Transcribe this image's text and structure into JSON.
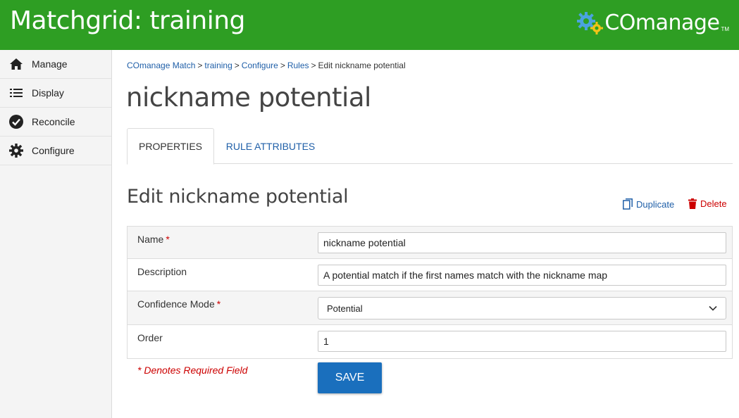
{
  "header": {
    "app_title": "Matchgrid: training",
    "logo_text": "COmanage",
    "logo_tm": "TM"
  },
  "sidebar": {
    "items": [
      {
        "label": "Manage",
        "icon": "home-icon"
      },
      {
        "label": "Display",
        "icon": "list-icon"
      },
      {
        "label": "Reconcile",
        "icon": "check-circle-icon"
      },
      {
        "label": "Configure",
        "icon": "gear-icon"
      }
    ]
  },
  "breadcrumb": {
    "items": [
      "COmanage Match",
      "training",
      "Configure",
      "Rules"
    ],
    "separator": ">",
    "current": "Edit nickname potential"
  },
  "page": {
    "title": "nickname potential",
    "tabs": [
      "PROPERTIES",
      "RULE ATTRIBUTES"
    ],
    "section_title": "Edit nickname potential",
    "duplicate_label": "Duplicate",
    "delete_label": "Delete"
  },
  "form": {
    "name_label": "Name",
    "name_value": "nickname potential",
    "description_label": "Description",
    "description_value": "A potential match if the first names match with the nickname map",
    "confidence_label": "Confidence Mode",
    "confidence_value": "Potential",
    "order_label": "Order",
    "order_value": "1",
    "required_marker": "*",
    "required_note": "* Denotes Required Field",
    "save_label": "SAVE"
  },
  "colors": {
    "header_green": "#2e9e23",
    "link_blue": "#1f5fa8",
    "required_red": "#cc0000",
    "save_blue": "#1a6fbd"
  }
}
